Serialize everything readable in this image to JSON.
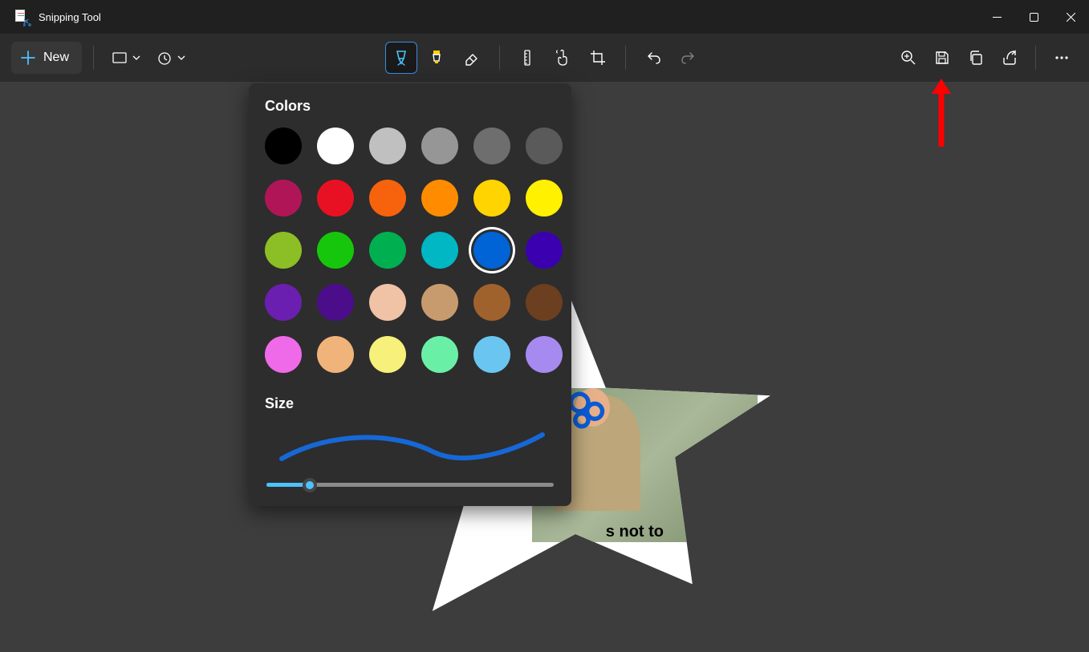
{
  "app": {
    "title": "Snipping Tool"
  },
  "toolbar": {
    "new_label": "New"
  },
  "panel": {
    "colors_heading": "Colors",
    "size_heading": "Size",
    "swatches": [
      "#000000",
      "#ffffff",
      "#c0c0c0",
      "#969696",
      "#6e6e6e",
      "#5a5a5a",
      "#b01657",
      "#e81123",
      "#f7630c",
      "#ff8c00",
      "#ffd400",
      "#fff100",
      "#8cbf26",
      "#16c60c",
      "#00b050",
      "#00b7c3",
      "#0063d6",
      "#3b00b0",
      "#6b1fb0",
      "#4b0d8a",
      "#f0c2a6",
      "#c89b6e",
      "#a0622d",
      "#6b3f1f",
      "#ef6ae8",
      "#f0b37a",
      "#f7f07a",
      "#6af0a6",
      "#6ac6f0",
      "#a68af0"
    ],
    "selected_color_index": 10,
    "selected_color_row": 2,
    "selected_color_col": 4,
    "selected_color_hex": "#0063d6",
    "size_value_percent": 15
  },
  "canvas": {
    "star_caption_fragment": "s not to"
  }
}
